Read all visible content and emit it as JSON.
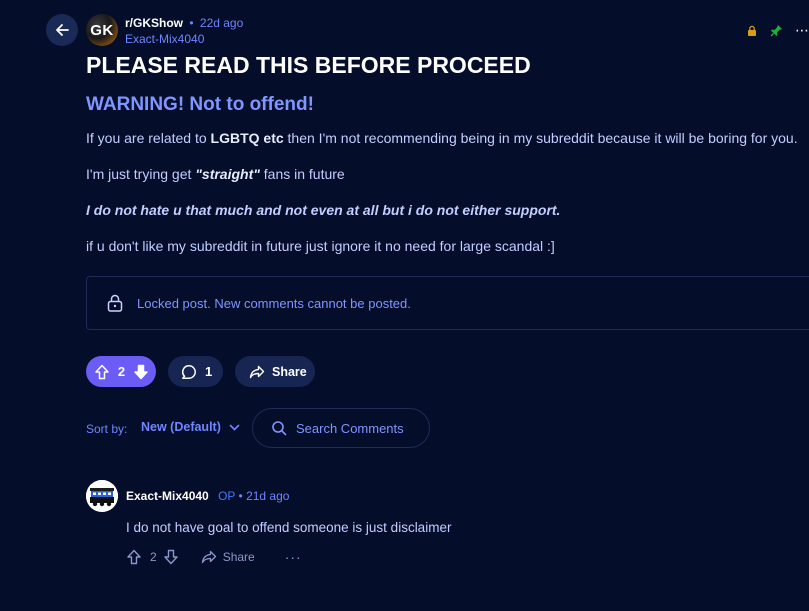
{
  "colors": {
    "background": "#040d2a",
    "accent": "#6f86ff",
    "upvote_active": "#6a5cf5",
    "pill_bg": "#162552"
  },
  "header": {
    "back_icon": "arrow-left-icon",
    "subreddit_avatar_text": "GK",
    "subreddit": "r/GKShow",
    "separator": "•",
    "time": "22d ago",
    "author": "Exact-Mix4040",
    "icons": [
      "lock-icon",
      "pin-icon",
      "more-icon"
    ],
    "more_label": "⋯"
  },
  "post": {
    "title": "PLEASE READ THIS BEFORE PROCEED",
    "subheading": "WARNING! Not to offend!",
    "p1": {
      "before": "If you are related to ",
      "bold": "LGBTQ etc",
      "after": " then I'm not recommending being in my subreddit because it will be boring for you."
    },
    "p2": {
      "before": "I'm just trying get ",
      "bold_italic": "\"straight\"",
      "after": " fans in future"
    },
    "p3": "I do not hate u that much and not even at all but i do not either support.",
    "p4": "if u don't like my subreddit in future just ignore it no need for large scandal :]",
    "locked_notice": "Locked post. New comments cannot be posted."
  },
  "actions": {
    "score": "2",
    "comments": "1",
    "share": "Share"
  },
  "sort": {
    "label": "Sort by:",
    "value": "New (Default)"
  },
  "search": {
    "placeholder": "Search Comments"
  },
  "comment": {
    "author": "Exact-Mix4040",
    "op_badge": "OP",
    "separator": "•",
    "time": "21d ago",
    "body": "I do not have goal to offend someone is just disclaimer",
    "score": "2",
    "share": "Share",
    "more": "···"
  }
}
